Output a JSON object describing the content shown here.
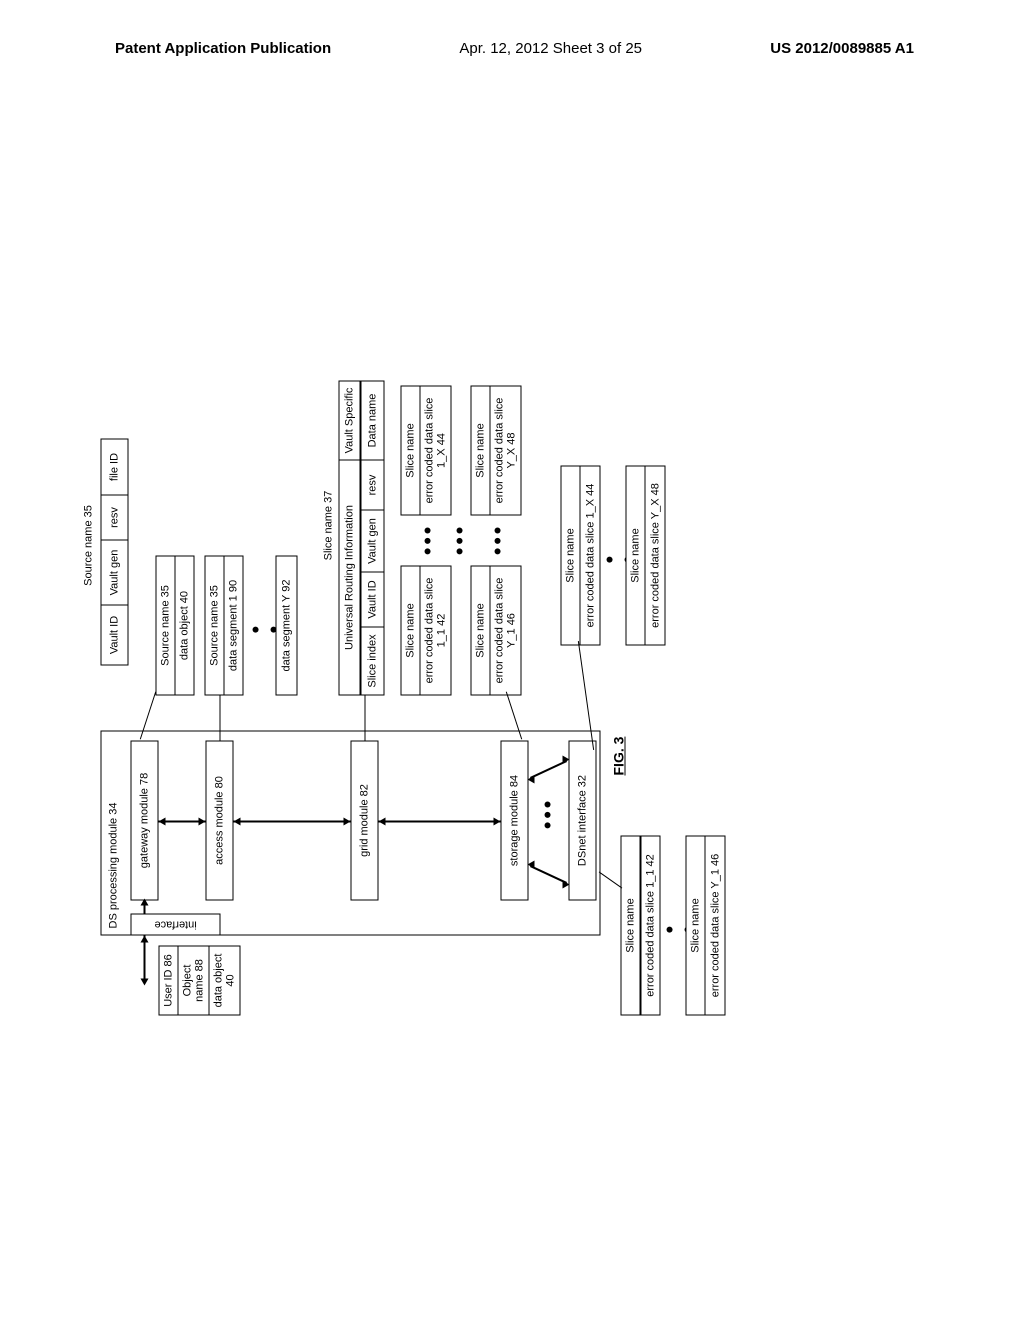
{
  "header": {
    "left": "Patent Application Publication",
    "mid": "Apr. 12, 2012  Sheet 3 of 25",
    "right": "US 2012/0089885 A1"
  },
  "figure_label": "FIG. 3",
  "ds_module": {
    "title": "DS processing module 34",
    "gateway": "gateway module 78",
    "access": "access module 80",
    "grid": "grid module 82",
    "storage": "storage module 84",
    "dsnet": "DSnet interface 32",
    "interface": "interface"
  },
  "inputs": {
    "user_id": "User ID 86",
    "object_name": "Object name 88",
    "data_object": "data object 40"
  },
  "source_name": {
    "title": "Source name 35",
    "cells": [
      "Vault ID",
      "Vault gen",
      "resv",
      "file ID"
    ]
  },
  "source_block1": {
    "top": "Source name 35",
    "bottom": "data object 40"
  },
  "source_block2": {
    "top": "Source name 35",
    "bottom": "data segment 1 90"
  },
  "source_seg_y": "data segment Y 92",
  "slice_name": {
    "title": "Slice name 37",
    "uri": "Universal Routing Information",
    "vault": "Vault Specific",
    "cells": [
      "Slice index",
      "Vault ID",
      "Vault gen",
      "resv",
      "Data name"
    ]
  },
  "slices": {
    "sn": "Slice name",
    "ec_1_1": "error coded data slice 1_1 42",
    "ec_1_x": "error coded data slice 1_X 44",
    "ec_y_1": "error coded data slice Y_1 46",
    "ec_y_x": "error coded data slice Y_X 48"
  }
}
